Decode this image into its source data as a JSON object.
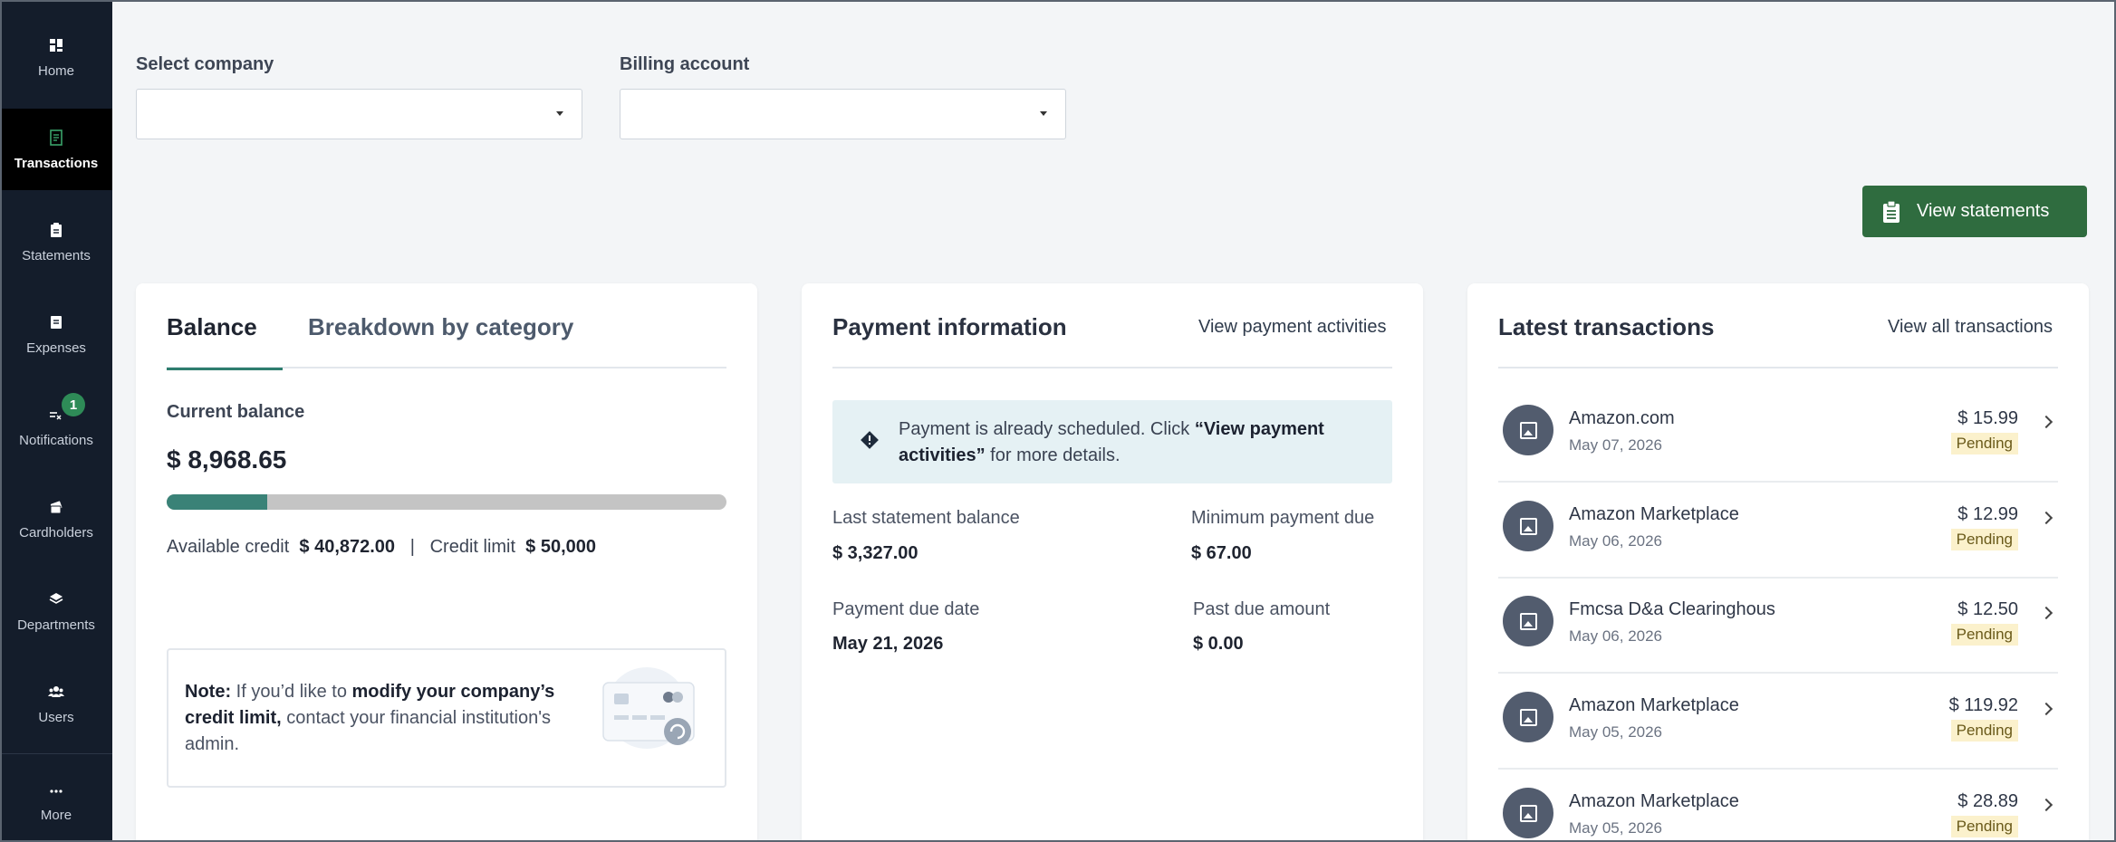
{
  "sidebar": {
    "items": [
      {
        "label": "Home",
        "icon": "dashboard-icon"
      },
      {
        "label": "Transactions",
        "icon": "receipt-icon"
      },
      {
        "label": "Statements",
        "icon": "clipboard-icon"
      },
      {
        "label": "Expenses",
        "icon": "document-icon"
      },
      {
        "label": "Notifications",
        "icon": "notification-icon"
      },
      {
        "label": "Cardholders",
        "icon": "cards-icon"
      },
      {
        "label": "Departments",
        "icon": "layers-icon"
      },
      {
        "label": "Users",
        "icon": "users-icon"
      },
      {
        "label": "More",
        "icon": "more-icon"
      }
    ],
    "active": "Transactions",
    "notification_count": "1"
  },
  "filters": {
    "company_label": "Select company",
    "company_value": "",
    "billing_label": "Billing account",
    "billing_value": ""
  },
  "actions": {
    "view_statements": "View statements"
  },
  "balance_card": {
    "tab_balance": "Balance",
    "tab_breakdown": "Breakdown by category",
    "current_balance_label": "Current balance",
    "current_balance": "$ 8,968.65",
    "used_fraction": 0.18,
    "available_credit_label": "Available credit",
    "available_credit": "$ 40,872.00",
    "separator": "|",
    "credit_limit_label": "Credit limit",
    "credit_limit": "$ 50,000",
    "note_prefix": "Note:",
    "note_mid1": " If you’d like to ",
    "note_bold": "modify your company’s credit limit,",
    "note_suffix": " contact your financial institution's admin."
  },
  "payment_card": {
    "title": "Payment information",
    "link": "View payment activities",
    "alert_prefix": "Payment is already scheduled. Click ",
    "alert_bold": "“View payment activities”",
    "alert_suffix": " for more details.",
    "last_statement_label": "Last statement balance",
    "last_statement_value": "$ 3,327.00",
    "minimum_label": "Minimum payment due",
    "minimum_value": "$ 67.00",
    "due_date_label": "Payment due date",
    "due_date_value": "May 21, 2026",
    "past_due_label": "Past due amount",
    "past_due_value": "$ 0.00"
  },
  "transactions_card": {
    "title": "Latest transactions",
    "link": "View all transactions",
    "items": [
      {
        "merchant": "Amazon.com",
        "date": "May 07, 2026",
        "amount": "$ 15.99",
        "status": "Pending"
      },
      {
        "merchant": "Amazon Marketplace",
        "date": "May 06, 2026",
        "amount": "$ 12.99",
        "status": "Pending"
      },
      {
        "merchant": "Fmcsa D&a Clearinghous",
        "date": "May 06, 2026",
        "amount": "$ 12.50",
        "status": "Pending"
      },
      {
        "merchant": "Amazon Marketplace",
        "date": "May 05, 2026",
        "amount": "$ 119.92",
        "status": "Pending"
      },
      {
        "merchant": "Amazon Marketplace",
        "date": "May 05, 2026",
        "amount": "$ 28.89",
        "status": "Pending"
      }
    ]
  },
  "colors": {
    "sidebar": "#141d2b",
    "accent_green": "#2f6c3f",
    "progress_fill": "#3a8277",
    "pending_bg": "#fbf1cc"
  }
}
